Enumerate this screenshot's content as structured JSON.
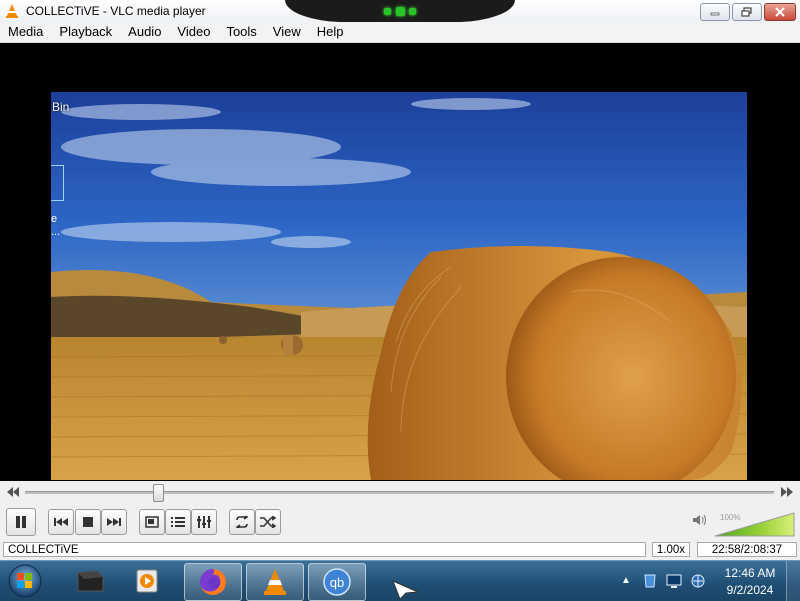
{
  "window": {
    "title": "COLLECTiVE - VLC media player"
  },
  "menu": {
    "items": [
      "Media",
      "Playback",
      "Audio",
      "Video",
      "Tools",
      "View",
      "Help"
    ]
  },
  "desktop_overlay": {
    "bin_label": "Bin",
    "ghost_text_1": "e",
    "ghost_text_2": "..."
  },
  "player": {
    "seek_position_fraction": 0.177,
    "volume_label": "100%",
    "volume_fraction": 1.0
  },
  "status": {
    "media_name": "COLLECTiVE",
    "speed": "1.00x",
    "time": "22:58/2:08:37"
  },
  "taskbar": {
    "clock_time": "12:46 AM",
    "clock_date": "9/2/2024",
    "qb_label": "qb"
  },
  "colors": {
    "vlc_orange": "#f28a00",
    "taskbar_blue": "#1f4e74"
  }
}
